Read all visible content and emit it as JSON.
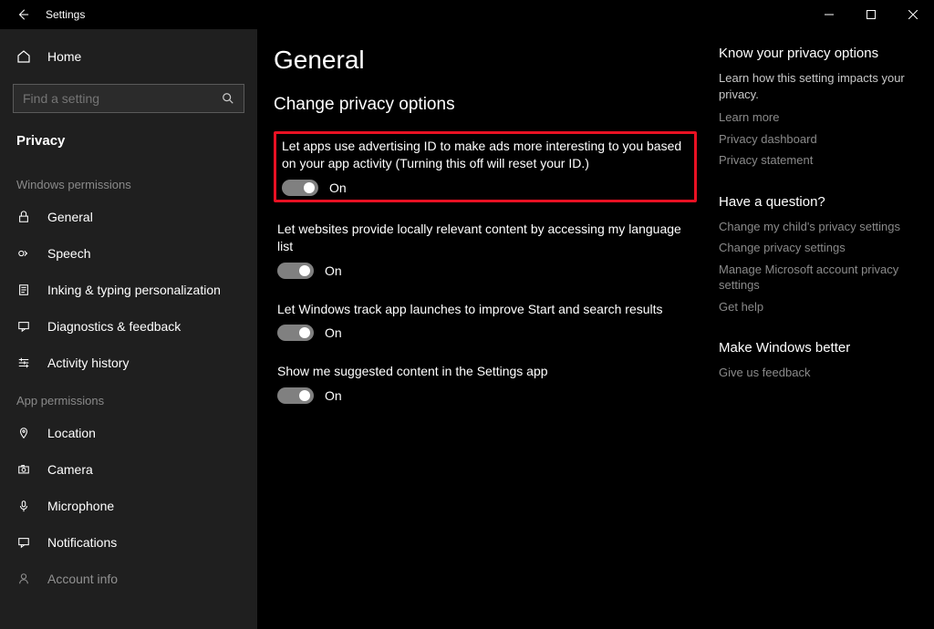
{
  "titlebar": {
    "title": "Settings"
  },
  "sidebar": {
    "home": "Home",
    "search_placeholder": "Find a setting",
    "category": "Privacy",
    "section1_header": "Windows permissions",
    "win_perms": [
      {
        "label": "General"
      },
      {
        "label": "Speech"
      },
      {
        "label": "Inking & typing personalization"
      },
      {
        "label": "Diagnostics & feedback"
      },
      {
        "label": "Activity history"
      }
    ],
    "section2_header": "App permissions",
    "app_perms": [
      {
        "label": "Location"
      },
      {
        "label": "Camera"
      },
      {
        "label": "Microphone"
      },
      {
        "label": "Notifications"
      },
      {
        "label": "Account info"
      }
    ]
  },
  "main": {
    "title": "General",
    "subtitle": "Change privacy options",
    "settings": [
      {
        "label": "Let apps use advertising ID to make ads more interesting to you based on your app activity (Turning this off will reset your ID.)",
        "state": "On"
      },
      {
        "label": "Let websites provide locally relevant content by accessing my language list",
        "state": "On"
      },
      {
        "label": "Let Windows track app launches to improve Start and search results",
        "state": "On"
      },
      {
        "label": "Show me suggested content in the Settings app",
        "state": "On"
      }
    ]
  },
  "rail": {
    "sec1": {
      "heading": "Know your privacy options",
      "desc": "Learn how this setting impacts your privacy.",
      "links": [
        "Learn more",
        "Privacy dashboard",
        "Privacy statement"
      ]
    },
    "sec2": {
      "heading": "Have a question?",
      "links": [
        "Change my child's privacy settings",
        "Change privacy settings",
        "Manage Microsoft account privacy settings",
        "Get help"
      ]
    },
    "sec3": {
      "heading": "Make Windows better",
      "links": [
        "Give us feedback"
      ]
    }
  }
}
